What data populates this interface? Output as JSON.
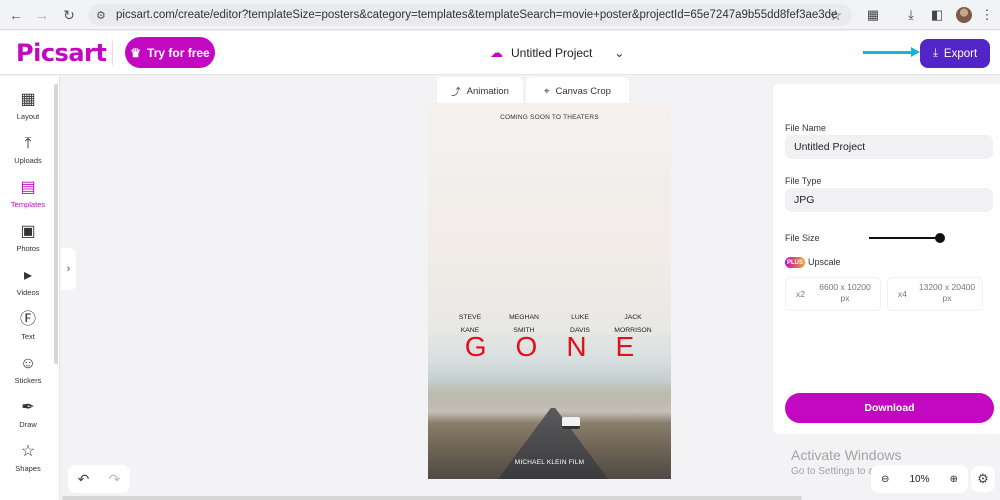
{
  "browser": {
    "url": "picsart.com/create/editor?templateSize=posters&category=templates&templateSearch=movie+poster&projectId=65e7247a9b55dd8fef3ae3de",
    "icons": [
      "back-icon",
      "forward-icon",
      "reload-icon",
      "site-info-icon",
      "bookmark-star-icon",
      "extensions-icon",
      "download-icon",
      "sidebar-icon",
      "profile-avatar",
      "more-icon"
    ]
  },
  "header": {
    "logo": "Picsart",
    "try_free": "Try for free",
    "project_name": "Untitled Project",
    "export": "Export",
    "accent_color": "#c209c1",
    "export_color": "#5225c7"
  },
  "tools": [
    {
      "label": "Layout",
      "icon": "layout-icon"
    },
    {
      "label": "Uploads",
      "icon": "upload-icon"
    },
    {
      "label": "Templates",
      "icon": "templates-icon",
      "active": true
    },
    {
      "label": "Photos",
      "icon": "photos-icon"
    },
    {
      "label": "Videos",
      "icon": "videos-icon"
    },
    {
      "label": "Text",
      "icon": "text-icon"
    },
    {
      "label": "Stickers",
      "icon": "stickers-icon"
    },
    {
      "label": "Draw",
      "icon": "brush-icon"
    },
    {
      "label": "Shapes",
      "icon": "shapes-icon"
    }
  ],
  "canvas_tabs": {
    "animation": "Animation",
    "crop": "Canvas Crop"
  },
  "poster": {
    "tagline": "COMING SOON TO THEATERS",
    "cast": [
      {
        "first": "STEVE",
        "last": "KANE"
      },
      {
        "first": "MEGHAN",
        "last": "SMITH"
      },
      {
        "first": "LUKE",
        "last": "DAVIS"
      },
      {
        "first": "JACK",
        "last": "MORRISON"
      }
    ],
    "title": "GONE",
    "credit": "MICHAEL KLEIN FILM"
  },
  "export_panel": {
    "file_name_label": "File Name",
    "file_name": "Untitled Project",
    "file_type_label": "File Type",
    "file_type": "JPG",
    "file_size_label": "File Size",
    "file_size_level": 1.0,
    "plus_badge": "PLUS",
    "upscale_label": "Upscale",
    "upscale_options": [
      {
        "mult": "x2",
        "res_line1": "6600 x 10200",
        "res_line2": "px"
      },
      {
        "mult": "x4",
        "res_line1": "13200 x 20400",
        "res_line2": "px"
      }
    ],
    "download": "Download"
  },
  "watermark": {
    "line1": "Activate Windows",
    "line2": "Go to Settings to activate Windows."
  },
  "zoom": {
    "level": "10%"
  }
}
